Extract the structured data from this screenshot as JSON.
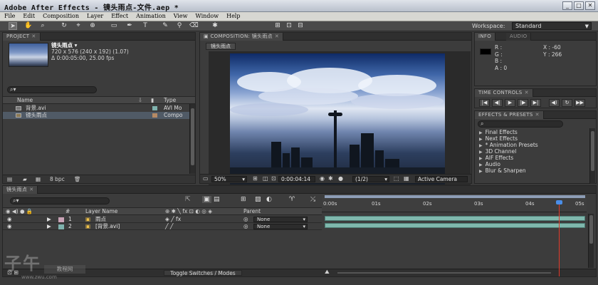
{
  "window": {
    "title": "Adobe After Effects - 镜头雨点-文件.aep *",
    "minimize": "_",
    "maximize": "□",
    "close": "✕"
  },
  "menu": [
    "File",
    "Edit",
    "Composition",
    "Layer",
    "Effect",
    "Animation",
    "View",
    "Window",
    "Help"
  ],
  "toolbar": {
    "workspace_label": "Workspace:",
    "workspace_value": "Standard"
  },
  "project": {
    "tab": "PROJECT",
    "item_name": "镜头雨点 ▾",
    "item_dims": "720 x 576 (240 x 192) (1.07)",
    "item_time": "Δ 0:00:05:00, 25.00 fps",
    "search_placeholder": "",
    "columns": {
      "name": "Name",
      "type": "Type"
    },
    "rows": [
      {
        "name": "背景.avi",
        "type": "AVI Mo",
        "color": "#7fb2ad"
      },
      {
        "name": "镜头雨点",
        "type": "Compo",
        "color": "#b58a65"
      }
    ],
    "footer_bpc": "8 bpc"
  },
  "composition": {
    "tab": "COMPOSITION: 镜头雨点",
    "comp_label": "镜头雨点",
    "zoom": "50%",
    "timecode": "0:00:04:14",
    "resolution": "(1/2)",
    "camera": "Active Camera"
  },
  "info": {
    "tab_info": "INFO",
    "tab_audio": "AUDIO",
    "r": "R :",
    "g": "G :",
    "b": "B :",
    "a": "A : 0",
    "x": "X : -60",
    "y": "Y : 266"
  },
  "time_controls": {
    "tab": "TIME CONTROLS"
  },
  "effects_presets": {
    "tab": "EFFECTS & PRESETS",
    "items": [
      "Final Effects",
      "Next Effects",
      "* Animation Presets",
      "3D Channel",
      "AIF Effects",
      "Audio",
      "Blur & Sharpen"
    ]
  },
  "timeline": {
    "tab": "镜头雨点",
    "columns": {
      "num": "#",
      "layer_name": "Layer Name",
      "parent": "Parent"
    },
    "layers": [
      {
        "num": "1",
        "name": "雨点",
        "parent": "None"
      },
      {
        "num": "2",
        "name": "[背景.avi]",
        "parent": "None"
      }
    ],
    "ruler_labels": [
      "0:00s",
      "01s",
      "02s",
      "03s",
      "04s",
      "05s"
    ],
    "toggle_label": "Toggle Switches / Modes"
  },
  "colors": {
    "track": "#7fb8ad",
    "playhead": "#e23a2a",
    "selection": "#505a66"
  },
  "watermark": {
    "main": "子午",
    "sub": "教程网",
    "url": "www.zwu.com"
  }
}
